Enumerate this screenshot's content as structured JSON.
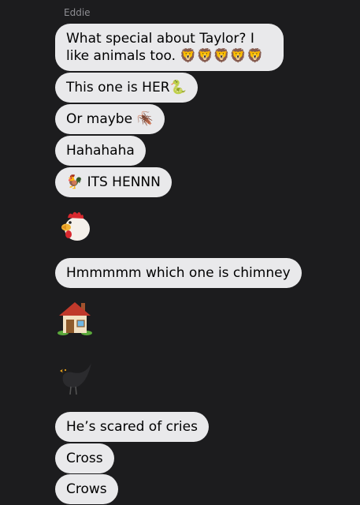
{
  "conversation": {
    "sender_name": "Eddie",
    "messages": [
      {
        "type": "text",
        "text": "What special about Taylor? I like animals too. 🦁🦁🦁🦁🦁"
      },
      {
        "type": "text",
        "text": "This one is HER🐍"
      },
      {
        "type": "text",
        "text": "Or maybe 🪳"
      },
      {
        "type": "text",
        "text": "Hahahaha"
      },
      {
        "type": "text",
        "text": "🐓 ITS HENNN"
      },
      {
        "type": "emoji",
        "icon": "chicken-emoji"
      },
      {
        "type": "text",
        "text": "Hmmmmm which one is chimney"
      },
      {
        "type": "emoji",
        "icon": "house-emoji"
      },
      {
        "type": "emoji",
        "icon": "crow-emoji"
      },
      {
        "type": "text",
        "text": "He’s scared of cries"
      },
      {
        "type": "text",
        "text": "Cross"
      },
      {
        "type": "text",
        "text": "Crows"
      }
    ]
  },
  "colors": {
    "background": "#1c1c1e",
    "bubble": "#e9e9eb",
    "sender_label": "#8e8e93"
  }
}
